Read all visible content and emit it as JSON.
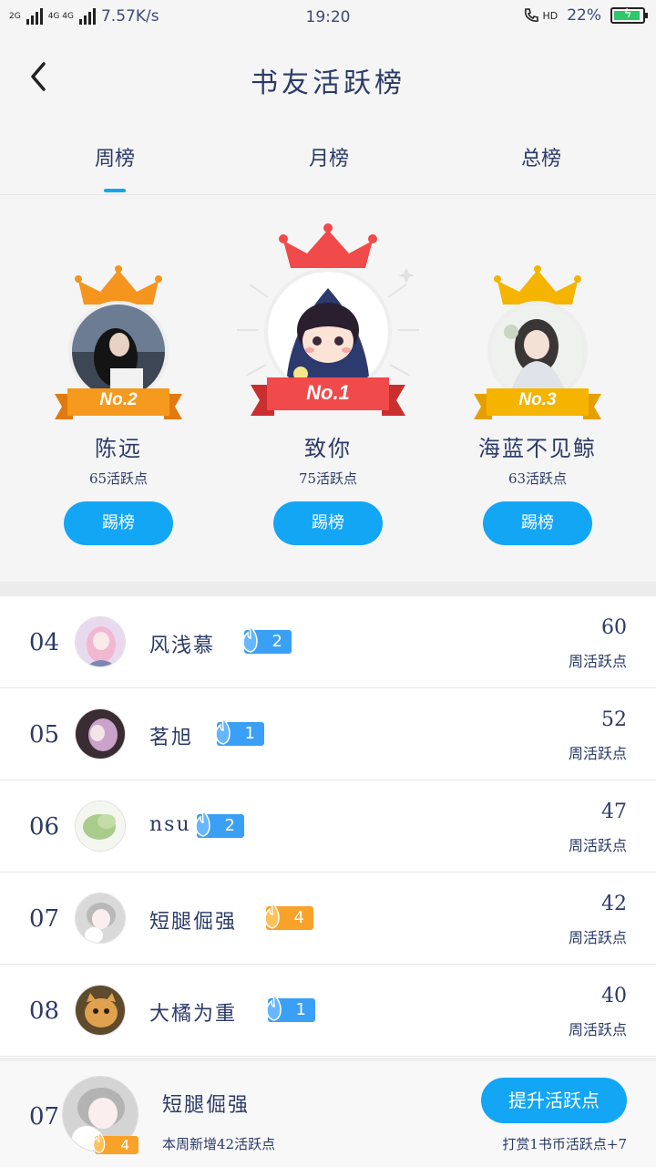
{
  "status_bar": {
    "network_top": "2G",
    "network_4g": "4G 4G",
    "speed": "7.57K/s",
    "time": "19:20",
    "hd": "HD",
    "battery": "22%"
  },
  "header": {
    "title": "书友活跃榜"
  },
  "tabs": [
    {
      "label": "周榜",
      "active": true
    },
    {
      "label": "月榜",
      "active": false
    },
    {
      "label": "总榜",
      "active": false
    }
  ],
  "podium": {
    "first": {
      "rank_label": "No.1",
      "name": "致你",
      "points": "75活跃点",
      "button": "踢榜"
    },
    "second": {
      "rank_label": "No.2",
      "name": "陈远",
      "points": "65活跃点",
      "button": "踢榜"
    },
    "third": {
      "rank_label": "No.3",
      "name": "海蓝不见鲸",
      "points": "63活跃点",
      "button": "踢榜"
    }
  },
  "list": [
    {
      "rank": "04",
      "name": "风浅慕",
      "level": "2",
      "score": "60",
      "score_label": "周活跃点",
      "badge_color": "#3aa0f5"
    },
    {
      "rank": "05",
      "name": "茗旭",
      "level": "1",
      "score": "52",
      "score_label": "周活跃点",
      "badge_color": "#3aa0f5"
    },
    {
      "rank": "06",
      "name": "nsu",
      "level": "2",
      "score": "47",
      "score_label": "周活跃点",
      "badge_color": "#3aa0f5"
    },
    {
      "rank": "07",
      "name": "短腿倔强",
      "level": "4",
      "score": "42",
      "score_label": "周活跃点",
      "badge_color": "#f9a22a"
    },
    {
      "rank": "08",
      "name": "大橘为重",
      "level": "1",
      "score": "40",
      "score_label": "周活跃点",
      "badge_color": "#3aa0f5"
    }
  ],
  "me": {
    "rank": "07",
    "name": "短腿倔强",
    "level": "4",
    "sub": "本周新增42活跃点",
    "button": "提升活跃点",
    "reward": "打赏1书币活跃点+7"
  },
  "colors": {
    "accent": "#13a6f5",
    "text": "#2b3a67",
    "gold": "#f5b400",
    "red": "#f04a4a",
    "orange": "#f59a1e"
  }
}
